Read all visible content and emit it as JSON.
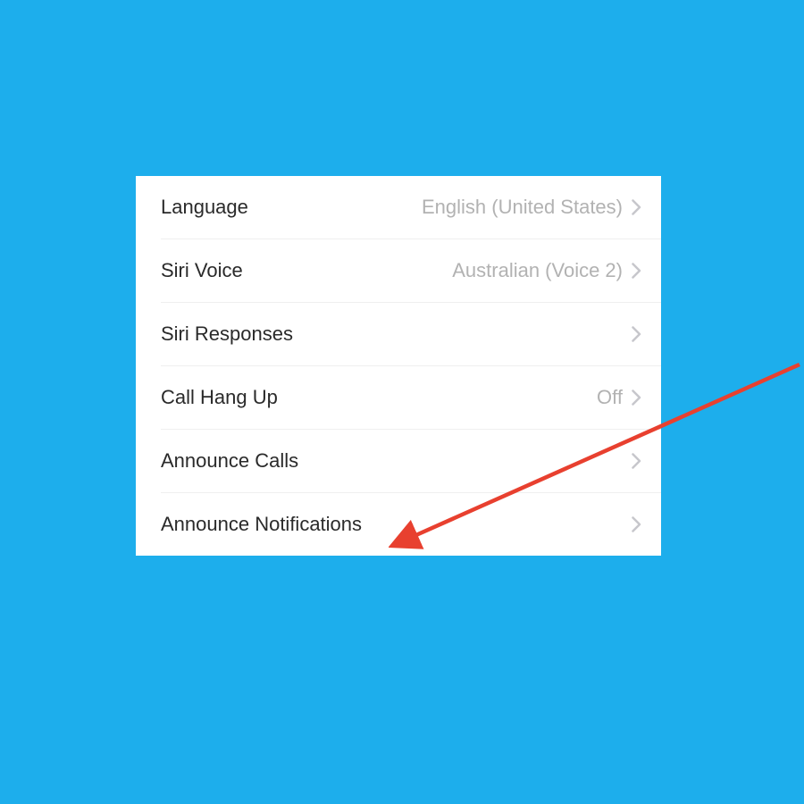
{
  "settings": {
    "rows": [
      {
        "label": "Language",
        "value": "English (United States)"
      },
      {
        "label": "Siri Voice",
        "value": "Australian (Voice 2)"
      },
      {
        "label": "Siri Responses",
        "value": ""
      },
      {
        "label": "Call Hang Up",
        "value": "Off"
      },
      {
        "label": "Announce Calls",
        "value": ""
      },
      {
        "label": "Announce Notifications",
        "value": ""
      }
    ]
  },
  "annotation": {
    "arrow_color": "#E8402F"
  }
}
